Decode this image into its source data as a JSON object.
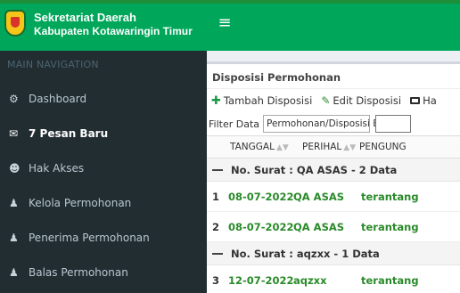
{
  "logo": {
    "line1": "Sekretariat Daerah",
    "line2": "Kabupaten Kotawaringin Timur"
  },
  "topbar": {
    "menu_icon": "hamburger-icon"
  },
  "sidebar": {
    "header": "MAIN NAVIGATION",
    "items": [
      {
        "label": "Dashboard",
        "icon": "dashboard-icon",
        "glyph": "⚙"
      },
      {
        "label": "7 Pesan Baru",
        "icon": "message-icon",
        "glyph": "✉"
      },
      {
        "label": "Hak Akses",
        "icon": "user-icon",
        "glyph": "☻"
      },
      {
        "label": "Kelola Permohonan",
        "icon": "users-icon",
        "glyph": "♟"
      },
      {
        "label": "Penerima Permohonan",
        "icon": "users-icon",
        "glyph": "♟"
      },
      {
        "label": "Balas Permohonan",
        "icon": "users-icon",
        "glyph": "♟"
      }
    ]
  },
  "panel": {
    "title": "Disposisi Permohonan",
    "toolbar": {
      "add_label": "Tambah Disposisi",
      "edit_label": "Edit Disposisi",
      "third_label": "Ha"
    },
    "filter": {
      "label": "Filter Data",
      "selected": "Permohonan/Disposisi E",
      "search_value": ""
    },
    "columns": [
      "TANGGAL",
      "PERIHAL",
      "PENGUNG"
    ],
    "groups": [
      {
        "label": "No. Surat : QA ASAS - 2 Data",
        "rows": [
          {
            "no": "1",
            "tanggal": "08-07-2022",
            "perihal": "QA ASAS",
            "pengunggah": "terantang"
          },
          {
            "no": "2",
            "tanggal": "08-07-2022",
            "perihal": "QA ASAS",
            "pengunggah": "terantang"
          }
        ]
      },
      {
        "label": "No. Surat : aqzxx - 1 Data",
        "rows": [
          {
            "no": "3",
            "tanggal": "12-07-2022",
            "perihal": "aqzxx",
            "pengunggah": "terantang"
          }
        ]
      }
    ]
  },
  "colors": {
    "header_green": "#00a65a",
    "sidebar_dark": "#222d32",
    "text_green": "#2a8a2a"
  }
}
